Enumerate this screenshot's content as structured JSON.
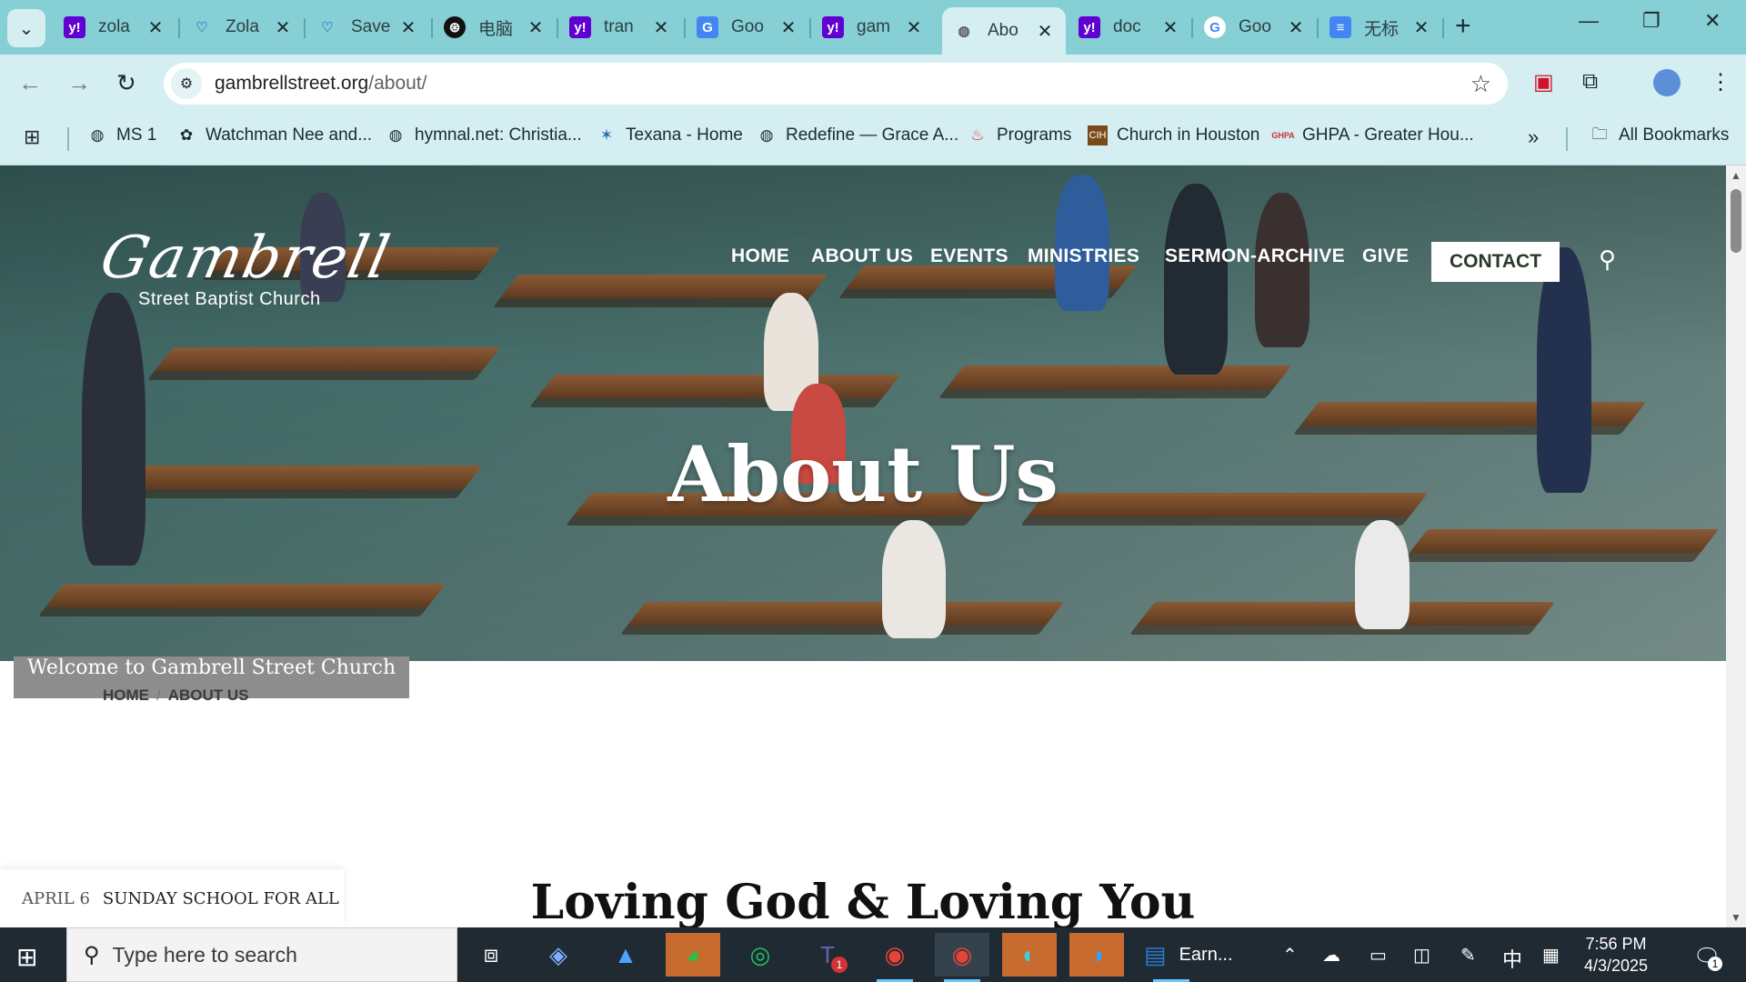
{
  "browser": {
    "tabs": [
      {
        "title": "zola",
        "icon": "yahoo-icon",
        "active": false
      },
      {
        "title": "Zola",
        "icon": "heart-icon",
        "active": false
      },
      {
        "title": "Save",
        "icon": "heart-icon",
        "active": false
      },
      {
        "title": "电脑",
        "icon": "openai-icon",
        "active": false
      },
      {
        "title": "tran",
        "icon": "yahoo-icon",
        "active": false
      },
      {
        "title": "Goo",
        "icon": "google-translate-icon",
        "active": false
      },
      {
        "title": "gam",
        "icon": "yahoo-icon",
        "active": false
      },
      {
        "title": "Abo",
        "icon": "globe-icon",
        "active": true
      },
      {
        "title": "doc",
        "icon": "yahoo-icon",
        "active": false
      },
      {
        "title": "Goo",
        "icon": "google-icon",
        "active": false
      },
      {
        "title": "无标",
        "icon": "docs-icon",
        "active": false
      }
    ],
    "url_host": "gambrellstreet.org",
    "url_path": "/about/",
    "bookmarks": [
      {
        "label": "MS 1",
        "icon": "globe-icon"
      },
      {
        "label": "Watchman Nee and...",
        "icon": "flower-icon"
      },
      {
        "label": "hymnal.net: Christia...",
        "icon": "globe-icon"
      },
      {
        "label": "Texana - Home",
        "icon": "star-figure-icon"
      },
      {
        "label": "Redefine — Grace A...",
        "icon": "globe-icon"
      },
      {
        "label": "Programs",
        "icon": "flame-icon"
      },
      {
        "label": "Church in Houston",
        "icon": "cih-icon"
      },
      {
        "label": "GHPA - Greater Hou...",
        "icon": "ghpa-icon"
      }
    ],
    "all_bookmarks_label": "All Bookmarks"
  },
  "site": {
    "logo_script": "Gambrell",
    "logo_sub": "Street Baptist Church",
    "nav": [
      "HOME",
      "ABOUT US",
      "EVENTS",
      "MINISTRIES",
      "SERMON-ARCHIVE",
      "GIVE"
    ],
    "contact_label": "CONTACT",
    "hero_title": "About Us",
    "welcome": "Welcome to Gambrell Street Church",
    "breadcrumb": [
      "HOME",
      "ABOUT US"
    ],
    "event_date": "APRIL 6",
    "event_name": "SUNDAY SCHOOL FOR ALL",
    "section_title": "Loving God & Loving You"
  },
  "taskbar": {
    "search_placeholder": "Type here to search",
    "active_app_label": "Earn...",
    "time": "7:56 PM",
    "date": "4/3/2025",
    "ime_label": "中",
    "notification_count": "1",
    "teams_badge": "1"
  },
  "colors": {
    "tabstrip": "#86cfd4",
    "toolbar": "#d4eef1",
    "taskbar": "#1f2a33"
  }
}
